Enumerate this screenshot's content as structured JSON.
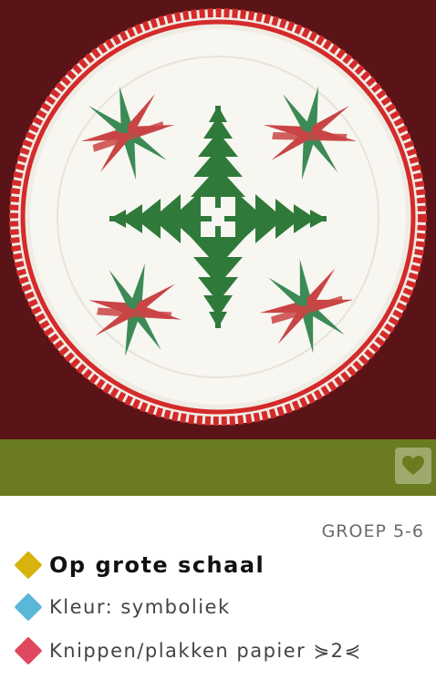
{
  "image": {
    "subject": "paper plate with green Christmas trees and red-green stars",
    "colors": {
      "background": "#5a1418",
      "plate": "#f3f1ea",
      "rim": "#d42a2a",
      "tree": "#2f7a3a",
      "star_red": "#c94545",
      "star_green": "#3c8a55"
    }
  },
  "band": {
    "color": "#6a7c1f",
    "favorite_icon": "heart-icon"
  },
  "group_label": "GROEP 5-6",
  "details": [
    {
      "text": "Op grote schaal",
      "color": "#d8b20d",
      "icon": "diamond-icon"
    },
    {
      "text": "Kleur: symboliek",
      "color": "#5bb7d8",
      "icon": "diamond-icon"
    },
    {
      "text": "Knippen/plakken papier ⋟2⋞",
      "color": "#e0485f",
      "icon": "diamond-icon"
    }
  ]
}
